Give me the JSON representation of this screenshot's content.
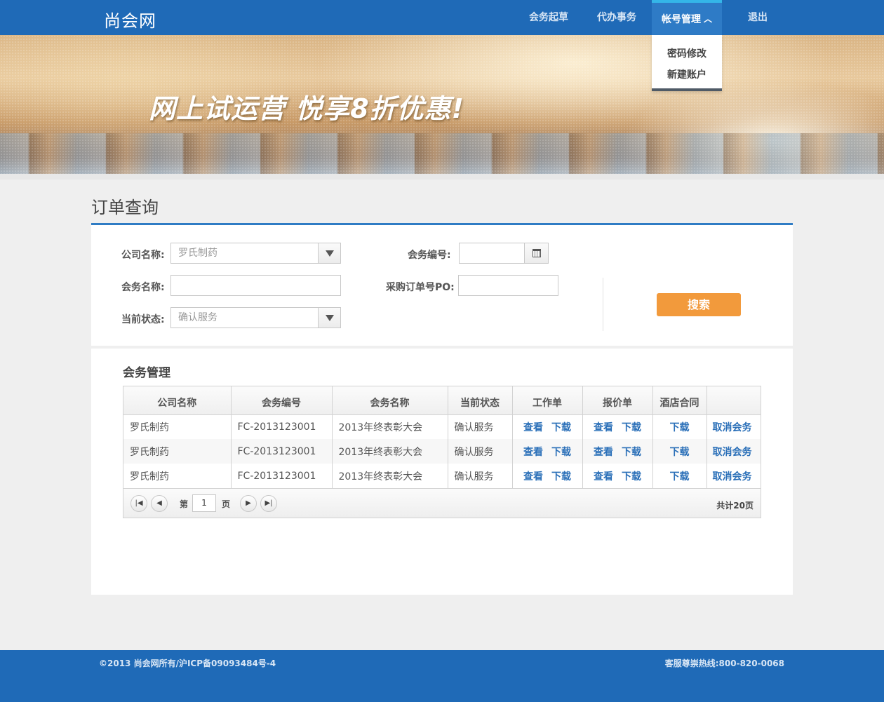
{
  "header": {
    "logo": "尚会网",
    "nav": {
      "drafting": "会务起草",
      "agent": "代办事务",
      "account": "帐号管理",
      "logout": "退出"
    },
    "account_menu": {
      "change_password": "密码修改",
      "new_account": "新建账户"
    }
  },
  "banner": {
    "slogan": "网上试运营 悦享8折优惠!"
  },
  "page": {
    "title": "订单查询"
  },
  "search": {
    "company_label": "公司名称:",
    "company_value": "罗氏制药",
    "meeting_no_label": "会务编号:",
    "meeting_no_value": "",
    "meeting_name_label": "会务名称:",
    "meeting_name_value": "",
    "po_label": "采购订单号PO:",
    "po_value": "",
    "status_label": "当前状态:",
    "status_value": "确认服务",
    "search_button": "搜索"
  },
  "management": {
    "title": "会务管理",
    "columns": [
      "公司名称",
      "会务编号",
      "会务名称",
      "当前状态",
      "工作单",
      "报价单",
      "酒店合同",
      ""
    ],
    "rows": [
      {
        "company": "罗氏制药",
        "no": "FC-2013123001",
        "name": "2013年终表彰大会",
        "status": "确认服务",
        "view": "查看",
        "download": "下载",
        "cancel": "取消会务"
      },
      {
        "company": "罗氏制药",
        "no": "FC-2013123001",
        "name": "2013年终表彰大会",
        "status": "确认服务",
        "view": "查看",
        "download": "下载",
        "cancel": "取消会务"
      },
      {
        "company": "罗氏制药",
        "no": "FC-2013123001",
        "name": "2013年终表彰大会",
        "status": "确认服务",
        "view": "查看",
        "download": "下载",
        "cancel": "取消会务"
      }
    ],
    "pager": {
      "prefix": "第",
      "page": "1",
      "suffix": "页",
      "total": "共计20页"
    }
  },
  "footer": {
    "copyright": "©2013 尚会网所有/沪ICP备09093484号-4",
    "hotline": "客服尊崇热线:800-820-0068"
  },
  "colors": {
    "brand_blue": "#1f6ab7",
    "accent_orange": "#f29a3c",
    "link_blue": "#2a6fb8"
  }
}
